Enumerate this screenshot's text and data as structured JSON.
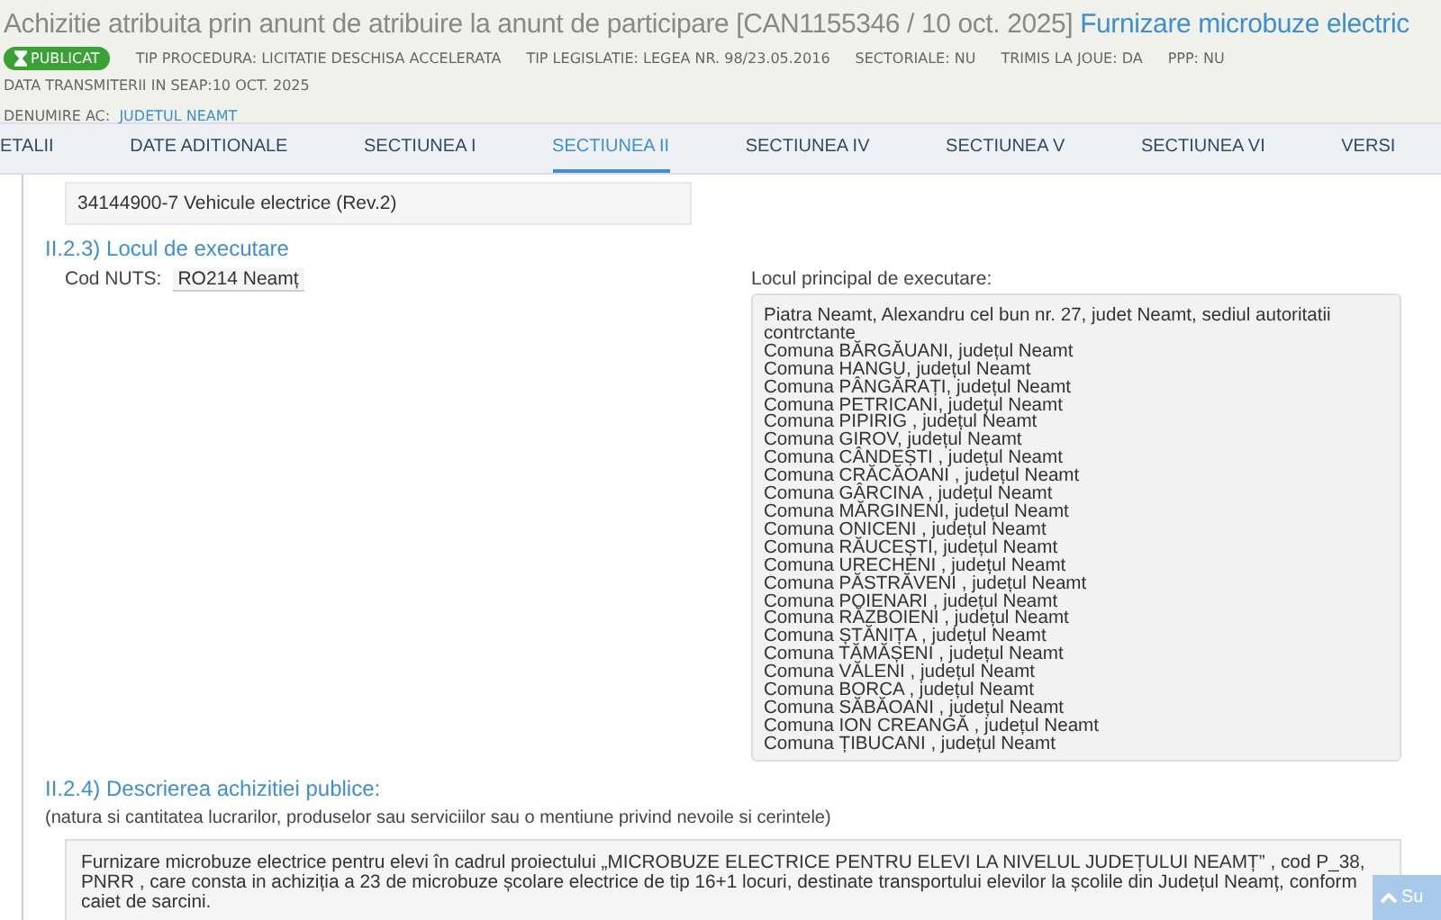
{
  "header": {
    "title": "Achizitie atribuita prin anunt de atribuire la anunt de participare [CAN1155346 / 10 oct. 2025]",
    "title_link": "Furnizare microbuze electric",
    "status_badge": "PUBLICAT",
    "meta": [
      "TIP PROCEDURA: LICITATIE DESCHISA ACCELERATA",
      "TIP LEGISLATIE: LEGEA NR. 98/23.05.2016",
      "SECTORIALE: NU",
      "TRIMIS LA JOUE: DA",
      "PPP: NU"
    ],
    "transmission_date": "DATA TRANSMITERII IN SEAP:10 OCT. 2025",
    "authority_label": "DENUMIRE AC:",
    "authority_link": "JUDETUL NEAMT"
  },
  "tabs": [
    {
      "label": "ETALII",
      "selected": false
    },
    {
      "label": "DATE ADITIONALE",
      "selected": false
    },
    {
      "label": "SECTIUNEA I",
      "selected": false
    },
    {
      "label": "SECTIUNEA II",
      "selected": true
    },
    {
      "label": "SECTIUNEA IV",
      "selected": false
    },
    {
      "label": "SECTIUNEA V",
      "selected": false
    },
    {
      "label": "SECTIUNEA VI",
      "selected": false
    },
    {
      "label": "VERSI",
      "selected": false
    }
  ],
  "cpv_code": "34144900-7 Vehicule electrice (Rev.2)",
  "place_section": {
    "heading": "II.2.3) Locul de executare",
    "nuts_label": "Cod NUTS:",
    "nuts_value": "RO214 Neamț",
    "main_place_label": "Locul principal de executare:",
    "main_place_lines": [
      "Piatra Neamt, Alexandru cel bun nr. 27, judet Neamt, sediul autoritatii contrctante",
      "Comuna BĂRGĂUANI, județul Neamt",
      "Comuna HANGU, județul Neamt",
      "Comuna PÂNGĂRAȚI, județul Neamt",
      "Comuna PETRICANI, județul Neamt",
      "Comuna PIPIRIG , județul Neamt",
      "Comuna GIROV, județul Neamt",
      "Comuna CÂNDEȘTI , județul Neamt",
      "Comuna CRĂCĂOANI , județul Neamt",
      "Comuna GÂRCINA , județul Neamt",
      "Comuna MĂRGINENI, județul Neamt",
      "Comuna ONICENI , județul Neamt",
      "Comuna RĂUCEȘTI, județul Neamt",
      "Comuna URECHENI , județul Neamt",
      "Comuna PĂSTRĂVENI , județul Neamt",
      "Comuna POIENARI , județul Neamt",
      "Comuna RĂZBOIENI , județul Neamt",
      "Comuna ȘTĂNIȚA , județul Neamt",
      "Comuna TĂMĂȘENI , județul Neamt",
      "Comuna VĂLENI , județul Neamt",
      "Comuna BORCA , județul Neamt",
      "Comuna SĂBĂOANI , județul Neamt",
      "Comuna ION CREANGĂ , județul Neamt",
      "Comuna ȚIBUCANI , județul Neamt"
    ]
  },
  "description_section": {
    "heading": "II.2.4) Descrierea achizitiei publice:",
    "note": "(natura si cantitatea lucrarilor, produselor sau serviciilor sau o mentiune privind nevoile si cerintele)",
    "text": "Furnizare microbuze electrice pentru elevi  în cadrul proiectului  „MICROBUZE ELECTRICE PENTRU ELEVI LA NIVELUL JUDEȚULUI NEAMȚ” , cod P_38, PNRR , care consta in achiziția a 23 de microbuze școlare electrice de  tip 16+1 locuri, destinate transportului elevilor la școlile din Județul Neamț, conform caiet de sarcini."
  },
  "scroll_top_button": "Su"
}
